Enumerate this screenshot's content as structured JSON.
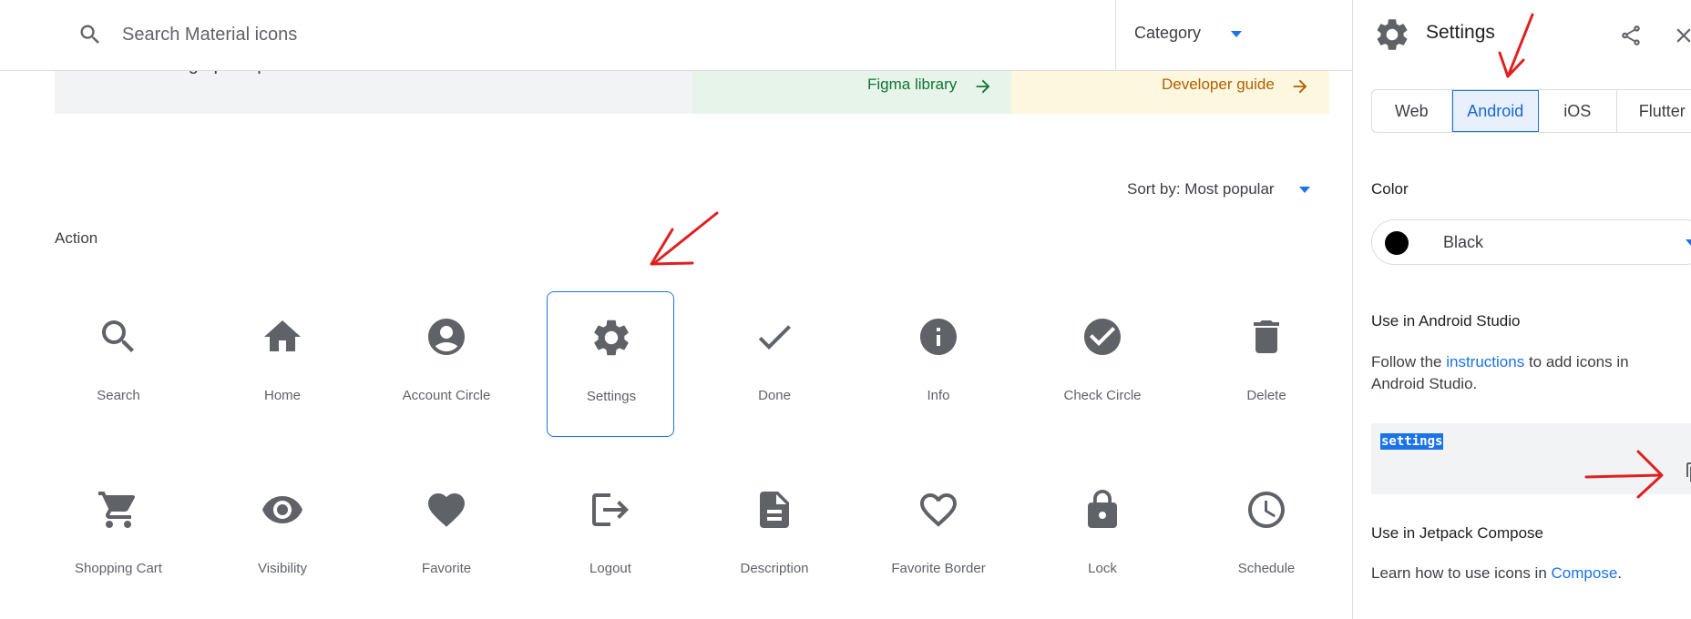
{
  "search": {
    "placeholder": "Search Material icons",
    "value": ""
  },
  "category": {
    "label": "Category"
  },
  "banner": {
    "description": "Material Design principles and metrics.",
    "figma_link": "Figma library",
    "developer_link": "Developer guide"
  },
  "sort": {
    "label": "Sort by: Most popular"
  },
  "section": {
    "title": "Action"
  },
  "icons": [
    {
      "label": "Search",
      "icon": "search-icon"
    },
    {
      "label": "Home",
      "icon": "home-icon"
    },
    {
      "label": "Account Circle",
      "icon": "account-circle-icon"
    },
    {
      "label": "Settings",
      "icon": "settings-icon",
      "selected": true
    },
    {
      "label": "Done",
      "icon": "done-icon"
    },
    {
      "label": "Info",
      "icon": "info-icon"
    },
    {
      "label": "Check Circle",
      "icon": "check-circle-icon"
    },
    {
      "label": "Delete",
      "icon": "delete-icon"
    },
    {
      "label": "Shopping Cart",
      "icon": "shopping-cart-icon"
    },
    {
      "label": "Visibility",
      "icon": "visibility-icon"
    },
    {
      "label": "Favorite",
      "icon": "favorite-icon"
    },
    {
      "label": "Logout",
      "icon": "logout-icon"
    },
    {
      "label": "Description",
      "icon": "description-icon"
    },
    {
      "label": "Favorite Border",
      "icon": "favorite-border-icon"
    },
    {
      "label": "Lock",
      "icon": "lock-icon"
    },
    {
      "label": "Schedule",
      "icon": "schedule-icon"
    }
  ],
  "panel": {
    "title": "Settings",
    "tabs": [
      "Web",
      "Android",
      "iOS",
      "Flutter"
    ],
    "active_tab": "Android",
    "color_label": "Color",
    "color_value": "Black",
    "android_heading": "Use in Android Studio",
    "android_text_before": "Follow the",
    "android_link": "instructions",
    "android_text_after": "to add icons in Android Studio.",
    "code": "settings",
    "compose_heading": "Use in Jetpack Compose",
    "compose_text_before": "Learn how to use icons in",
    "compose_link": "Compose",
    "compose_text_after": "."
  },
  "colors": {
    "accent": "#1a73e8",
    "icon_gray": "#5f6368",
    "annotation_red": "#e02020"
  }
}
